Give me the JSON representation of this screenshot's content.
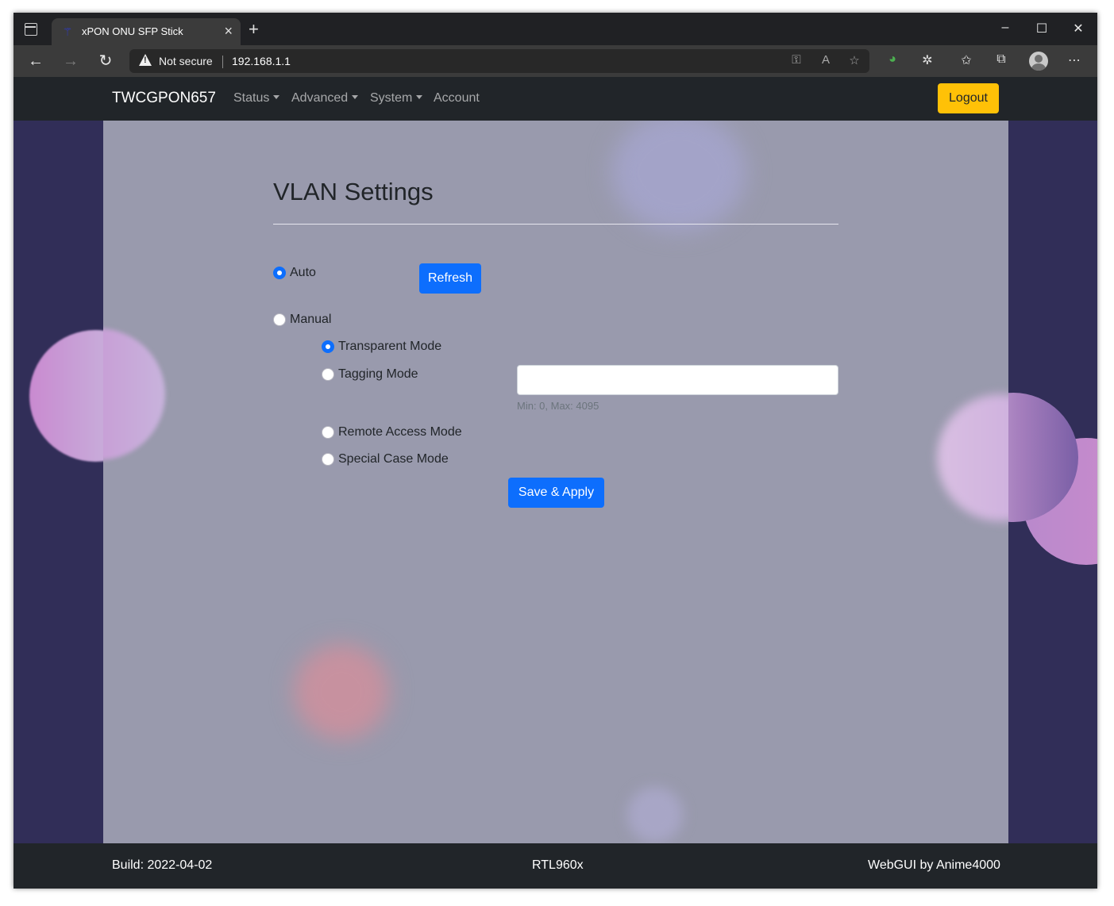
{
  "browser": {
    "tab_title": "xPON ONU SFP Stick",
    "security_label": "Not secure",
    "url": "192.168.1.1"
  },
  "navbar": {
    "brand": "TWCGPON657",
    "items": [
      {
        "label": "Status",
        "dropdown": true
      },
      {
        "label": "Advanced",
        "dropdown": true
      },
      {
        "label": "System",
        "dropdown": true
      },
      {
        "label": "Account",
        "dropdown": false
      }
    ],
    "logout_label": "Logout"
  },
  "vlan": {
    "title": "VLAN Settings",
    "mode_auto_label": "Auto",
    "mode_manual_label": "Manual",
    "selected_mode": "Auto",
    "refresh_label": "Refresh",
    "manual_options": [
      {
        "label": "Transparent Mode",
        "checked": true
      },
      {
        "label": "Tagging Mode",
        "checked": false
      },
      {
        "label": "Remote Access Mode",
        "checked": false
      },
      {
        "label": "Special Case Mode",
        "checked": false
      }
    ],
    "vlan_id_value": "",
    "vlan_id_help": "Min: 0, Max: 4095",
    "save_label": "Save & Apply"
  },
  "footer": {
    "build": "Build: 2022-04-02",
    "chip": "RTL960x",
    "credit": "WebGUI by Anime4000"
  },
  "colors": {
    "primary": "#0d6efd",
    "warning": "#ffc107",
    "navbar_bg": "#212529",
    "page_bg": "#312e58",
    "content_bg": "#999aad"
  }
}
